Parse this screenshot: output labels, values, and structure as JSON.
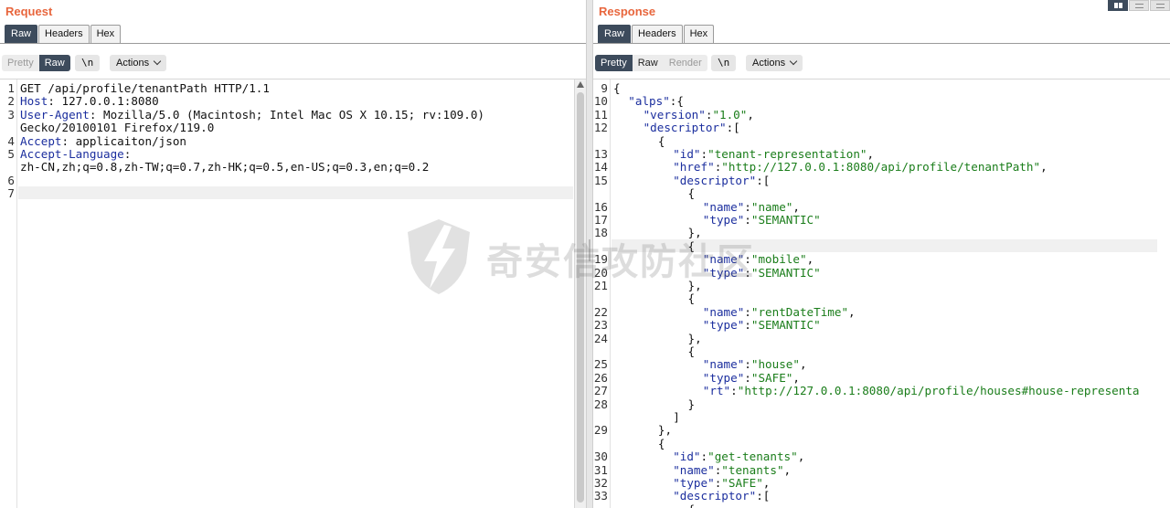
{
  "request": {
    "title": "Request",
    "tabs": [
      {
        "label": "Raw",
        "active": true
      },
      {
        "label": "Headers",
        "active": false
      },
      {
        "label": "Hex",
        "active": false
      }
    ],
    "view_toggle": {
      "pretty": "Pretty",
      "raw": "Raw",
      "selected": "Raw"
    },
    "newline_button": "\\n",
    "actions_button": "Actions",
    "lines": [
      {
        "num": "1",
        "segs": [
          {
            "t": "GET /api/profile/tenantPath HTTP/1.1",
            "c": "p"
          }
        ]
      },
      {
        "num": "2",
        "segs": [
          {
            "t": "Host",
            "c": "k"
          },
          {
            "t": ": 127.0.0.1:8080",
            "c": "p"
          }
        ]
      },
      {
        "num": "3",
        "segs": [
          {
            "t": "User-Agent",
            "c": "k"
          },
          {
            "t": ": Mozilla/5.0 (Macintosh; Intel Mac OS X 10.15; rv:109.0)",
            "c": "p"
          }
        ]
      },
      {
        "num": "",
        "segs": [
          {
            "t": "Gecko/20100101 Firefox/119.0",
            "c": "p"
          }
        ]
      },
      {
        "num": "4",
        "segs": [
          {
            "t": "Accept",
            "c": "k"
          },
          {
            "t": ": applicaiton/json",
            "c": "p"
          }
        ]
      },
      {
        "num": "5",
        "segs": [
          {
            "t": "Accept-Language",
            "c": "k"
          },
          {
            "t": ":",
            "c": "p"
          }
        ]
      },
      {
        "num": "",
        "segs": [
          {
            "t": "zh-CN,zh;q=0.8,zh-TW;q=0.7,zh-HK;q=0.5,en-US;q=0.3,en;q=0.2",
            "c": "p"
          }
        ]
      },
      {
        "num": "6",
        "segs": []
      },
      {
        "num": "7",
        "segs": [],
        "highlight": true
      }
    ]
  },
  "response": {
    "title": "Response",
    "tabs": [
      {
        "label": "Raw",
        "active": true
      },
      {
        "label": "Headers",
        "active": false
      },
      {
        "label": "Hex",
        "active": false
      }
    ],
    "view_toggle": {
      "pretty": "Pretty",
      "raw": "Raw",
      "render": "Render",
      "selected": "Pretty"
    },
    "newline_button": "\\n",
    "actions_button": "Actions",
    "lines": [
      {
        "num": "9",
        "indent": 0,
        "segs": [
          {
            "t": "{",
            "c": "p"
          }
        ]
      },
      {
        "num": "10",
        "indent": 1,
        "segs": [
          {
            "t": "\"alps\"",
            "c": "k"
          },
          {
            "t": ":{",
            "c": "p"
          }
        ]
      },
      {
        "num": "11",
        "indent": 2,
        "segs": [
          {
            "t": "\"version\"",
            "c": "k"
          },
          {
            "t": ":",
            "c": "p"
          },
          {
            "t": "\"1.0\"",
            "c": "s"
          },
          {
            "t": ",",
            "c": "p"
          }
        ]
      },
      {
        "num": "12",
        "indent": 2,
        "segs": [
          {
            "t": "\"descriptor\"",
            "c": "k"
          },
          {
            "t": ":[",
            "c": "p"
          }
        ]
      },
      {
        "num": "",
        "indent": 3,
        "segs": [
          {
            "t": "{",
            "c": "p"
          }
        ]
      },
      {
        "num": "13",
        "indent": 4,
        "segs": [
          {
            "t": "\"id\"",
            "c": "k"
          },
          {
            "t": ":",
            "c": "p"
          },
          {
            "t": "\"tenant-representation\"",
            "c": "s"
          },
          {
            "t": ",",
            "c": "p"
          }
        ]
      },
      {
        "num": "14",
        "indent": 4,
        "segs": [
          {
            "t": "\"href\"",
            "c": "k"
          },
          {
            "t": ":",
            "c": "p"
          },
          {
            "t": "\"http://127.0.0.1:8080/api/profile/tenantPath\"",
            "c": "s"
          },
          {
            "t": ",",
            "c": "p"
          }
        ]
      },
      {
        "num": "15",
        "indent": 4,
        "segs": [
          {
            "t": "\"descriptor\"",
            "c": "k"
          },
          {
            "t": ":[",
            "c": "p"
          }
        ]
      },
      {
        "num": "",
        "indent": 5,
        "segs": [
          {
            "t": "{",
            "c": "p"
          }
        ]
      },
      {
        "num": "16",
        "indent": 6,
        "segs": [
          {
            "t": "\"name\"",
            "c": "k"
          },
          {
            "t": ":",
            "c": "p"
          },
          {
            "t": "\"name\"",
            "c": "s"
          },
          {
            "t": ",",
            "c": "p"
          }
        ]
      },
      {
        "num": "17",
        "indent": 6,
        "segs": [
          {
            "t": "\"type\"",
            "c": "k"
          },
          {
            "t": ":",
            "c": "p"
          },
          {
            "t": "\"SEMANTIC\"",
            "c": "s"
          }
        ]
      },
      {
        "num": "18",
        "indent": 5,
        "segs": [
          {
            "t": "},",
            "c": "p"
          }
        ]
      },
      {
        "num": "",
        "indent": 5,
        "segs": [
          {
            "t": "{",
            "c": "p"
          }
        ],
        "highlight": true
      },
      {
        "num": "19",
        "indent": 6,
        "segs": [
          {
            "t": "\"name\"",
            "c": "k"
          },
          {
            "t": ":",
            "c": "p"
          },
          {
            "t": "\"mobile\"",
            "c": "s"
          },
          {
            "t": ",",
            "c": "p"
          }
        ]
      },
      {
        "num": "20",
        "indent": 6,
        "segs": [
          {
            "t": "\"type\"",
            "c": "k"
          },
          {
            "t": ":",
            "c": "p"
          },
          {
            "t": "\"SEMANTIC\"",
            "c": "s"
          }
        ]
      },
      {
        "num": "21",
        "indent": 5,
        "segs": [
          {
            "t": "},",
            "c": "p"
          }
        ]
      },
      {
        "num": "",
        "indent": 5,
        "segs": [
          {
            "t": "{",
            "c": "p"
          }
        ]
      },
      {
        "num": "22",
        "indent": 6,
        "segs": [
          {
            "t": "\"name\"",
            "c": "k"
          },
          {
            "t": ":",
            "c": "p"
          },
          {
            "t": "\"rentDateTime\"",
            "c": "s"
          },
          {
            "t": ",",
            "c": "p"
          }
        ]
      },
      {
        "num": "23",
        "indent": 6,
        "segs": [
          {
            "t": "\"type\"",
            "c": "k"
          },
          {
            "t": ":",
            "c": "p"
          },
          {
            "t": "\"SEMANTIC\"",
            "c": "s"
          }
        ]
      },
      {
        "num": "24",
        "indent": 5,
        "segs": [
          {
            "t": "},",
            "c": "p"
          }
        ]
      },
      {
        "num": "",
        "indent": 5,
        "segs": [
          {
            "t": "{",
            "c": "p"
          }
        ]
      },
      {
        "num": "25",
        "indent": 6,
        "segs": [
          {
            "t": "\"name\"",
            "c": "k"
          },
          {
            "t": ":",
            "c": "p"
          },
          {
            "t": "\"house\"",
            "c": "s"
          },
          {
            "t": ",",
            "c": "p"
          }
        ]
      },
      {
        "num": "26",
        "indent": 6,
        "segs": [
          {
            "t": "\"type\"",
            "c": "k"
          },
          {
            "t": ":",
            "c": "p"
          },
          {
            "t": "\"SAFE\"",
            "c": "s"
          },
          {
            "t": ",",
            "c": "p"
          }
        ]
      },
      {
        "num": "27",
        "indent": 6,
        "segs": [
          {
            "t": "\"rt\"",
            "c": "k"
          },
          {
            "t": ":",
            "c": "p"
          },
          {
            "t": "\"http://127.0.0.1:8080/api/profile/houses#house-representa",
            "c": "s"
          }
        ]
      },
      {
        "num": "28",
        "indent": 5,
        "segs": [
          {
            "t": "}",
            "c": "p"
          }
        ]
      },
      {
        "num": "",
        "indent": 4,
        "segs": [
          {
            "t": "]",
            "c": "p"
          }
        ]
      },
      {
        "num": "29",
        "indent": 3,
        "segs": [
          {
            "t": "},",
            "c": "p"
          }
        ]
      },
      {
        "num": "",
        "indent": 3,
        "segs": [
          {
            "t": "{",
            "c": "p"
          }
        ]
      },
      {
        "num": "30",
        "indent": 4,
        "segs": [
          {
            "t": "\"id\"",
            "c": "k"
          },
          {
            "t": ":",
            "c": "p"
          },
          {
            "t": "\"get-tenants\"",
            "c": "s"
          },
          {
            "t": ",",
            "c": "p"
          }
        ]
      },
      {
        "num": "31",
        "indent": 4,
        "segs": [
          {
            "t": "\"name\"",
            "c": "k"
          },
          {
            "t": ":",
            "c": "p"
          },
          {
            "t": "\"tenants\"",
            "c": "s"
          },
          {
            "t": ",",
            "c": "p"
          }
        ]
      },
      {
        "num": "32",
        "indent": 4,
        "segs": [
          {
            "t": "\"type\"",
            "c": "k"
          },
          {
            "t": ":",
            "c": "p"
          },
          {
            "t": "\"SAFE\"",
            "c": "s"
          },
          {
            "t": ",",
            "c": "p"
          }
        ]
      },
      {
        "num": "33",
        "indent": 4,
        "segs": [
          {
            "t": "\"descriptor\"",
            "c": "k"
          },
          {
            "t": ":[",
            "c": "p"
          }
        ]
      },
      {
        "num": "",
        "indent": 5,
        "segs": [
          {
            "t": "{",
            "c": "p"
          }
        ]
      }
    ]
  },
  "watermark": {
    "text": "奇安信攻防社区",
    "icon": "lightning-shield-icon"
  },
  "layout_icons": [
    "split-columns-icon",
    "split-rows-icon",
    "tabs-layout-icon"
  ],
  "colors": {
    "accent_title": "#e8663d",
    "active_tab": "#3d4b5c",
    "key": "#1b2e9e",
    "string": "#1a7d1a"
  }
}
